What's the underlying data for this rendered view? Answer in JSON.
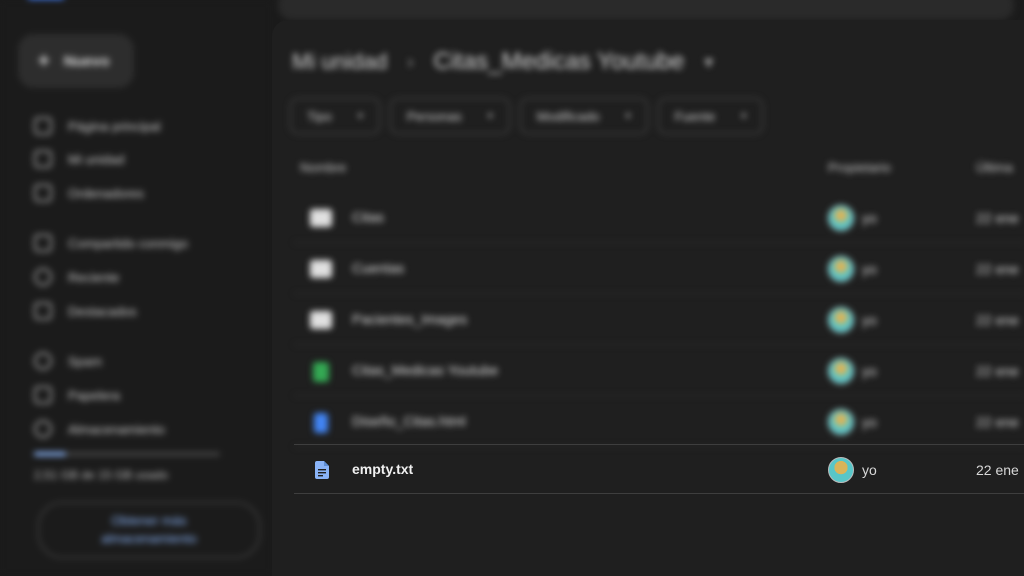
{
  "sidebar": {
    "new_label": "Nuevo",
    "items": [
      {
        "label": "Página principal",
        "icon": "home-icon"
      },
      {
        "label": "Mi unidad",
        "icon": "drive-icon"
      },
      {
        "label": "Ordenadores",
        "icon": "computer-icon"
      },
      {
        "label": "Compartido conmigo",
        "icon": "people-icon"
      },
      {
        "label": "Reciente",
        "icon": "clock-icon"
      },
      {
        "label": "Destacados",
        "icon": "star-icon"
      },
      {
        "label": "Spam",
        "icon": "spam-icon"
      },
      {
        "label": "Papelera",
        "icon": "trash-icon"
      },
      {
        "label": "Almacenamiento",
        "icon": "cloud-icon"
      }
    ],
    "storage_text": "2,51 GB de 15 GB usado",
    "storage_used_fraction": 0.17,
    "storage_button": "Obtener más almacenamiento"
  },
  "main": {
    "breadcrumb_root": "Mi unidad",
    "breadcrumb_current": "Citas_Medicas Youtube",
    "filters": [
      "Tipo",
      "Personas",
      "Modificado",
      "Fuente"
    ],
    "columns": {
      "name": "Nombre",
      "owner": "Propietario",
      "modified": "Última"
    },
    "rows": [
      {
        "name": "Citas",
        "type": "folder",
        "owner": "yo",
        "modified": "22 ene"
      },
      {
        "name": "Cuentas",
        "type": "folder",
        "owner": "yo",
        "modified": "22 ene"
      },
      {
        "name": "Pacientes_Images",
        "type": "folder",
        "owner": "yo",
        "modified": "22 ene"
      },
      {
        "name": "Citas_Medicas Youtube",
        "type": "sheet",
        "owner": "yo",
        "modified": "22 ene"
      },
      {
        "name": "Diseño_Citas.html",
        "type": "doc",
        "owner": "yo",
        "modified": "22 ene"
      },
      {
        "name": "empty.txt",
        "type": "txt",
        "owner": "yo",
        "modified": "22 ene"
      }
    ]
  },
  "colors": {
    "accent": "#8ab4f8",
    "sheet": "#34a853",
    "doc": "#4285f4",
    "folder": "#e0e0e0"
  }
}
